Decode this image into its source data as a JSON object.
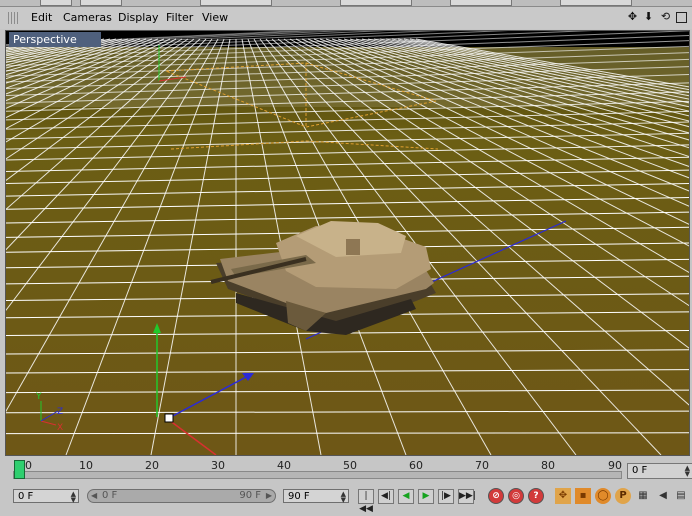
{
  "menu": {
    "items": [
      "Edit",
      "Cameras",
      "Display",
      "Filter",
      "View"
    ]
  },
  "viewport": {
    "label": "Perspective",
    "axis_labels": {
      "y": "Y",
      "x": "X",
      "z": "Z"
    }
  },
  "timeline": {
    "ticks": [
      "0",
      "10",
      "20",
      "30",
      "40",
      "50",
      "60",
      "70",
      "80",
      "90"
    ],
    "current_frame": "0 F"
  },
  "controls": {
    "current_frame": "0 F",
    "range_start": "0 F",
    "range_end": "90 F",
    "end_frame": "90 F",
    "range_left_arrow": "◀",
    "range_right_arrow": "▶"
  },
  "icons": {
    "nav_move": "✥",
    "nav_down": "⬇",
    "nav_rotate": "⟲",
    "go_start": "|◀◀",
    "step_back": "◀|",
    "play_back": "◀",
    "play_forward": "▶",
    "step_forward": "|▶",
    "go_end": "▶▶|",
    "record_key": "⊘",
    "record_off": "◎",
    "help": "?",
    "move_tool": "✥",
    "scale_tool": "▪",
    "rotate_tool": "◯",
    "pla_tool": "P",
    "grid_tool": "▦",
    "speaker": "◀",
    "doc": "▤"
  },
  "colors": {
    "floor": "#6a5a10",
    "grid": "#ffffff",
    "axis_y": "#22c82c",
    "axis_x": "#d83030",
    "axis_z": "#2a2ad8",
    "timeline_cursor": "#2fcf6f"
  }
}
